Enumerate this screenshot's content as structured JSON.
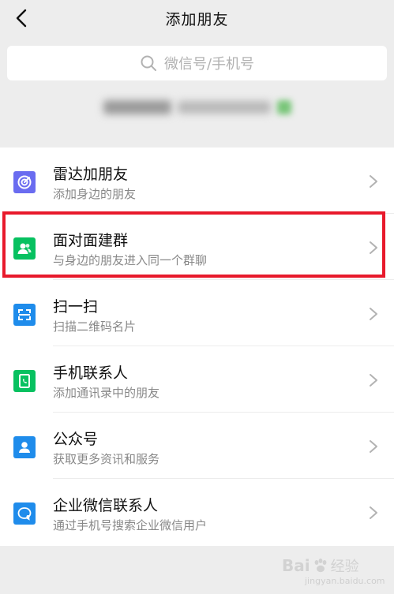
{
  "header": {
    "title": "添加朋友"
  },
  "search": {
    "placeholder": "微信号/手机号"
  },
  "list": {
    "items": [
      {
        "title": "雷达加朋友",
        "subtitle": "添加身边的朋友",
        "icon": "radar-icon",
        "color": "#6a6cf0"
      },
      {
        "title": "面对面建群",
        "subtitle": "与身边的朋友进入同一个群聊",
        "icon": "face-to-face-group-icon",
        "color": "#07c160"
      },
      {
        "title": "扫一扫",
        "subtitle": "扫描二维码名片",
        "icon": "scan-icon",
        "color": "#1f8ceb"
      },
      {
        "title": "手机联系人",
        "subtitle": "添加通讯录中的朋友",
        "icon": "phone-contacts-icon",
        "color": "#07c160"
      },
      {
        "title": "公众号",
        "subtitle": "获取更多资讯和服务",
        "icon": "official-account-icon",
        "color": "#1f8ceb"
      },
      {
        "title": "企业微信联系人",
        "subtitle": "通过手机号搜索企业微信用户",
        "icon": "wecom-contact-icon",
        "color": "#1f8ceb"
      }
    ]
  },
  "watermark": {
    "brand": "Bai",
    "brand2": "经验",
    "sub": "jingyan.baidu.com"
  }
}
